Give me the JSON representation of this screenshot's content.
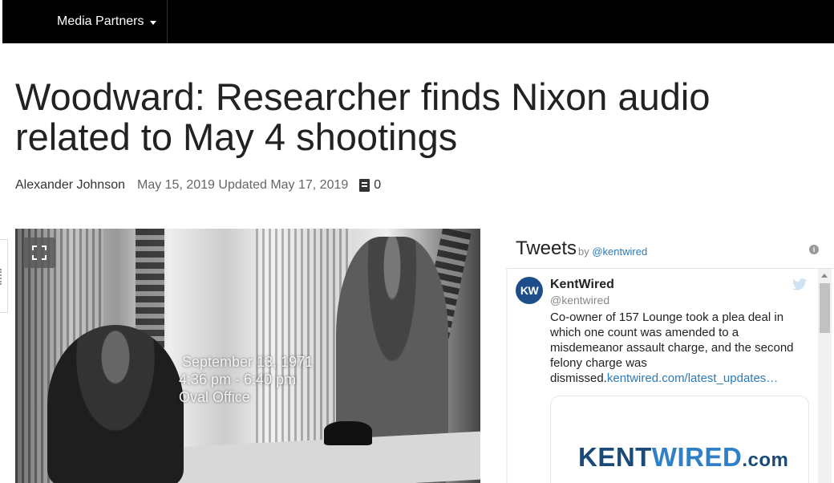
{
  "nav": {
    "media_partners_label": "Media Partners"
  },
  "article": {
    "headline": "Woodward: Researcher finds Nixon audio related to May 4 shootings",
    "author": "Alexander Johnson",
    "dates": "May 15, 2019 Updated May 17, 2019",
    "comment_count": "0"
  },
  "photo": {
    "caption_line1": "September 13, 1971",
    "caption_line2": "4:36 pm - 6:40 pm",
    "caption_line3": "Oval Office"
  },
  "tweets": {
    "title": "Tweets",
    "by_prefix": "by",
    "by_handle": "@kentwired",
    "tweet": {
      "avatar_initials": "KW",
      "name": "KentWired",
      "handle": "@kentwired",
      "text": "Co-owner of 157 Lounge took a plea deal in which one count was amended to a misdemeanor assault charge, and the second felony charge was dismissed.",
      "link": "kentwired.com/latest_updates…",
      "card_logo_part1": "KENT",
      "card_logo_part2": "WIRED",
      "card_logo_part3": ".com"
    }
  },
  "colors": {
    "nav_bg": "#000000",
    "link": "#2b7bb9",
    "avatar_bg": "#1d4e89"
  },
  "icons": [
    "caret-down-icon",
    "comment-icon",
    "expand-icon",
    "info-icon",
    "twitter-bird-icon",
    "scroll-up-icon"
  ]
}
